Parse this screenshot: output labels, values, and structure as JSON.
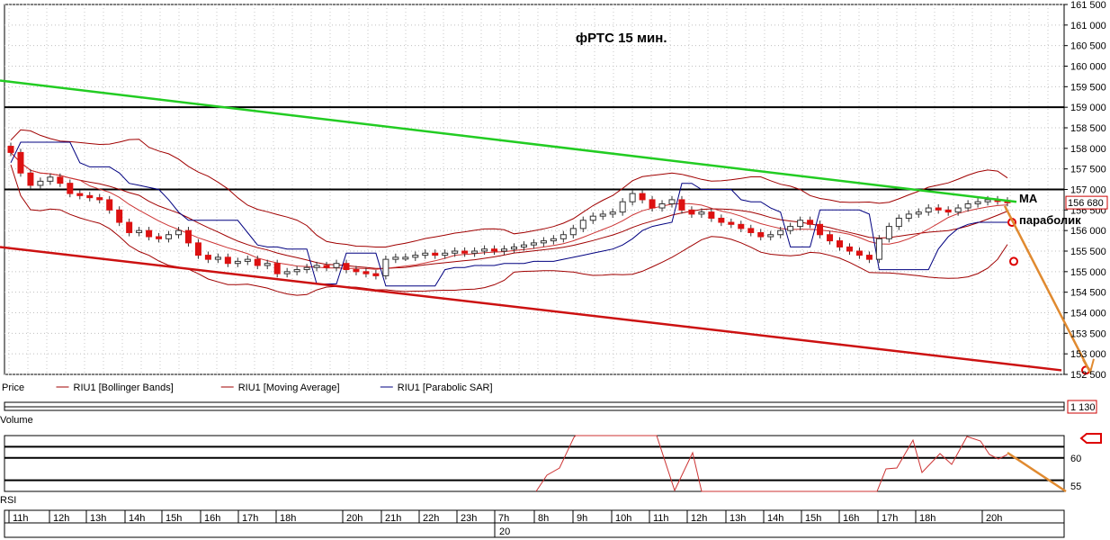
{
  "chart_data": {
    "type": "candlestick",
    "title": "фРТС   15 мин.",
    "price_axis": {
      "ylim": [
        152500,
        161500
      ],
      "ticks": [
        "161 500",
        "161 000",
        "160 500",
        "160 000",
        "159 500",
        "159 000",
        "158 500",
        "158 000",
        "157 500",
        "157 000",
        "156 500",
        "156 000",
        "155 500",
        "155 000",
        "154 500",
        "154 000",
        "153 500",
        "153 000",
        "152 500"
      ],
      "last_price_label": "156 680",
      "last_price": 156680
    },
    "time_axis": {
      "labels": [
        "11h",
        "12h",
        "13h",
        "14h",
        "15h",
        "16h",
        "17h",
        "18h",
        "20h",
        "21h",
        "22h",
        "23h",
        "7h",
        "8h",
        "9h",
        "10h",
        "11h",
        "12h",
        "13h",
        "14h",
        "15h",
        "16h",
        "17h",
        "18h",
        "20h"
      ],
      "date_label": "20"
    },
    "legend": [
      {
        "name": "Price",
        "color": "#000000"
      },
      {
        "name": "RIU1 [Bollinger Bands]",
        "color": "#a00000"
      },
      {
        "name": "RIU1 [Moving Average]",
        "color": "#a00000"
      },
      {
        "name": "RIU1 [Parabolic SAR]",
        "color": "#000080"
      }
    ],
    "candles_close": [
      157900,
      157400,
      157100,
      157200,
      157300,
      157150,
      156900,
      156850,
      156800,
      156750,
      156500,
      156200,
      155950,
      156000,
      155850,
      155800,
      155900,
      156000,
      155700,
      155400,
      155300,
      155350,
      155200,
      155250,
      155300,
      155150,
      155200,
      154950,
      155000,
      155050,
      155100,
      155150,
      155100,
      155200,
      155050,
      155000,
      154950,
      154900,
      155300,
      155350,
      155350,
      155400,
      155450,
      155400,
      155450,
      155500,
      155450,
      155500,
      155550,
      155500,
      155550,
      155600,
      155650,
      155700,
      155750,
      155800,
      155900,
      156050,
      156250,
      156350,
      156400,
      156450,
      156700,
      156900,
      156750,
      156550,
      156650,
      156750,
      156500,
      156400,
      156450,
      156300,
      156200,
      156150,
      156050,
      155950,
      155850,
      155900,
      156000,
      156100,
      156250,
      156150,
      155900,
      155750,
      155600,
      155500,
      155400,
      155300,
      155800,
      156100,
      156300,
      156400,
      156450,
      156550,
      156500,
      156450,
      156550,
      156650,
      156700,
      156750,
      156720,
      156680
    ],
    "horizontal_levels": [
      159000,
      157000
    ],
    "trendlines": [
      {
        "name": "green-resistance",
        "color": "#22cc22",
        "from": [
          0,
          159650
        ],
        "to": [
          1130,
          156700
        ]
      },
      {
        "name": "red-support",
        "color": "#cc1111",
        "from": [
          0,
          155600
        ],
        "to": [
          1180,
          152600
        ]
      },
      {
        "name": "orange-forecast",
        "color": "#e08a30",
        "from": [
          1117,
          156600
        ],
        "to": [
          1212,
          152550
        ]
      }
    ],
    "annotations": [
      {
        "text": "MA"
      },
      {
        "text": "параболик"
      }
    ],
    "volume": {
      "label": "Volume",
      "last_value_label": "1 130"
    },
    "rsi": {
      "label": "RSI",
      "ticks": [
        "60",
        "55"
      ],
      "ylim": [
        54,
        64
      ]
    }
  }
}
